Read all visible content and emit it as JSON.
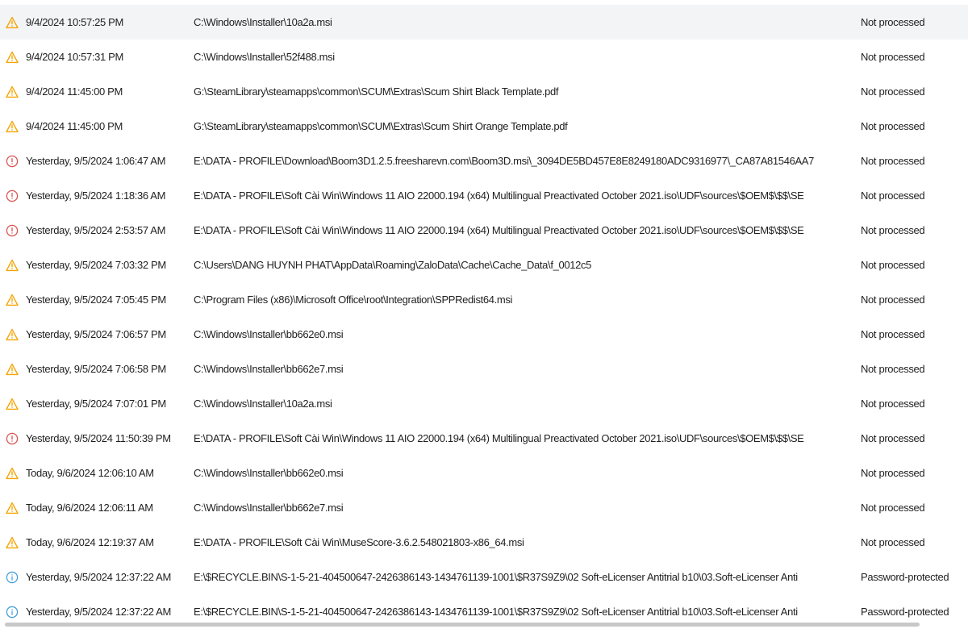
{
  "colors": {
    "warning": "#f4a400",
    "error": "#d9534f",
    "info": "#3b9ad9",
    "selected_row": "#f3f4f6"
  },
  "rows": [
    {
      "icon": "warning-icon",
      "date": "9/4/2024 10:57:25 PM",
      "path": "C:\\Windows\\Installer\\10a2a.msi",
      "status": "Not processed"
    },
    {
      "icon": "warning-icon",
      "date": "9/4/2024 10:57:31 PM",
      "path": "C:\\Windows\\Installer\\52f488.msi",
      "status": "Not processed"
    },
    {
      "icon": "warning-icon",
      "date": "9/4/2024 11:45:00 PM",
      "path": "G:\\SteamLibrary\\steamapps\\common\\SCUM\\Extras\\Scum Shirt Black Template.pdf",
      "status": "Not processed"
    },
    {
      "icon": "warning-icon",
      "date": "9/4/2024 11:45:00 PM",
      "path": "G:\\SteamLibrary\\steamapps\\common\\SCUM\\Extras\\Scum Shirt Orange Template.pdf",
      "status": "Not processed"
    },
    {
      "icon": "error-icon",
      "date": "Yesterday, 9/5/2024 1:06:47 AM",
      "path": "E:\\DATA - PROFILE\\Download\\Boom3D1.2.5.freesharevn.com\\Boom3D.msi\\_3094DE5BD457E8E8249180ADC9316977\\_CA87A81546AA7",
      "status": "Not processed"
    },
    {
      "icon": "error-icon",
      "date": "Yesterday, 9/5/2024 1:18:36 AM",
      "path": "E:\\DATA - PROFILE\\Soft Cài Win\\Windows 11 AIO 22000.194 (x64) Multilingual Preactivated October 2021.iso\\UDF\\sources\\$OEM$\\$$\\SE",
      "status": "Not processed"
    },
    {
      "icon": "error-icon",
      "date": "Yesterday, 9/5/2024 2:53:57 AM",
      "path": "E:\\DATA - PROFILE\\Soft Cài Win\\Windows 11 AIO 22000.194 (x64) Multilingual Preactivated October 2021.iso\\UDF\\sources\\$OEM$\\$$\\SE",
      "status": "Not processed"
    },
    {
      "icon": "warning-icon",
      "date": "Yesterday, 9/5/2024 7:03:32 PM",
      "path": "C:\\Users\\DANG HUYNH PHAT\\AppData\\Roaming\\ZaloData\\Cache\\Cache_Data\\f_0012c5",
      "status": "Not processed"
    },
    {
      "icon": "warning-icon",
      "date": "Yesterday, 9/5/2024 7:05:45 PM",
      "path": "C:\\Program Files (x86)\\Microsoft Office\\root\\Integration\\SPPRedist64.msi",
      "status": "Not processed"
    },
    {
      "icon": "warning-icon",
      "date": "Yesterday, 9/5/2024 7:06:57 PM",
      "path": "C:\\Windows\\Installer\\bb662e0.msi",
      "status": "Not processed"
    },
    {
      "icon": "warning-icon",
      "date": "Yesterday, 9/5/2024 7:06:58 PM",
      "path": "C:\\Windows\\Installer\\bb662e7.msi",
      "status": "Not processed"
    },
    {
      "icon": "warning-icon",
      "date": "Yesterday, 9/5/2024 7:07:01 PM",
      "path": "C:\\Windows\\Installer\\10a2a.msi",
      "status": "Not processed"
    },
    {
      "icon": "error-icon",
      "date": "Yesterday, 9/5/2024 11:50:39 PM",
      "path": "E:\\DATA - PROFILE\\Soft Cài Win\\Windows 11 AIO 22000.194 (x64) Multilingual Preactivated October 2021.iso\\UDF\\sources\\$OEM$\\$$\\SE",
      "status": "Not processed"
    },
    {
      "icon": "warning-icon",
      "date": "Today, 9/6/2024 12:06:10 AM",
      "path": "C:\\Windows\\Installer\\bb662e0.msi",
      "status": "Not processed"
    },
    {
      "icon": "warning-icon",
      "date": "Today, 9/6/2024 12:06:11 AM",
      "path": "C:\\Windows\\Installer\\bb662e7.msi",
      "status": "Not processed"
    },
    {
      "icon": "warning-icon",
      "date": "Today, 9/6/2024 12:19:37 AM",
      "path": "E:\\DATA - PROFILE\\Soft Cài Win\\MuseScore-3.6.2.548021803-x86_64.msi",
      "status": "Not processed"
    },
    {
      "icon": "info-icon",
      "date": "Yesterday, 9/5/2024 12:37:22 AM",
      "path": "E:\\$RECYCLE.BIN\\S-1-5-21-404500647-2426386143-1434761139-1001\\$R37S9Z9\\02 Soft-eLicenser Antitrial b10\\03.Soft-eLicenser Anti",
      "status": "Password-protected"
    },
    {
      "icon": "info-icon",
      "date": "Yesterday, 9/5/2024 12:37:22 AM",
      "path": "E:\\$RECYCLE.BIN\\S-1-5-21-404500647-2426386143-1434761139-1001\\$R37S9Z9\\02 Soft-eLicenser Antitrial b10\\03.Soft-eLicenser Anti",
      "status": "Password-protected"
    }
  ]
}
